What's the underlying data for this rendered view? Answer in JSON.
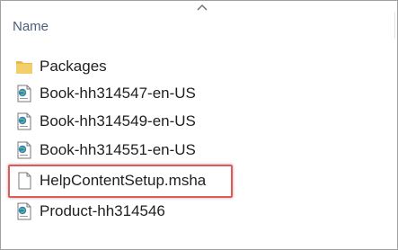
{
  "columns": {
    "name_label": "Name"
  },
  "files": [
    {
      "label": "Packages",
      "icon": "folder-icon"
    },
    {
      "label": "Book-hh314547-en-US",
      "icon": "web-document-icon"
    },
    {
      "label": "Book-hh314549-en-US",
      "icon": "web-document-icon"
    },
    {
      "label": "Book-hh314551-en-US",
      "icon": "web-document-icon"
    },
    {
      "label": "HelpContentSetup.msha",
      "icon": "blank-file-icon",
      "highlighted": true
    },
    {
      "label": "Product-hh314546",
      "icon": "web-document-icon"
    }
  ],
  "colors": {
    "highlight": "#e05a5a",
    "header_text": "#4c607a",
    "folder": "#e8b84a"
  }
}
